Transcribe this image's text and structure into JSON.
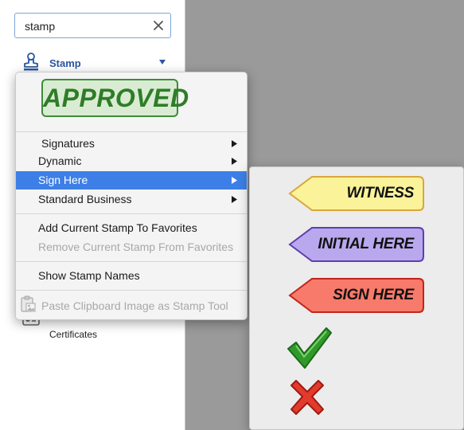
{
  "search": {
    "value": "stamp"
  },
  "tool": {
    "label": "Stamp",
    "icon": "stamp-icon"
  },
  "certificates": {
    "label": "Certificates",
    "icon": "certificate-icon"
  },
  "menu": {
    "preview_stamp_text": "APPROVED",
    "items": [
      {
        "label": "Signatures",
        "has_submenu": true,
        "state": "normal"
      },
      {
        "label": "Dynamic",
        "has_submenu": true,
        "state": "normal"
      },
      {
        "label": "Sign Here",
        "has_submenu": true,
        "state": "highlighted"
      },
      {
        "label": "Standard Business",
        "has_submenu": true,
        "state": "normal"
      },
      {
        "label": "Add Current Stamp To Favorites",
        "state": "normal"
      },
      {
        "label": "Remove Current Stamp From Favorites",
        "state": "disabled"
      },
      {
        "label": "Show Stamp Names",
        "state": "normal"
      },
      {
        "label": "Paste Clipboard Image as Stamp Tool",
        "state": "disabled",
        "icon": "clipboard-image-icon"
      }
    ]
  },
  "submenu": {
    "stamps": [
      {
        "label": "WITNESS",
        "color": "#fbf39a"
      },
      {
        "label": "INITIAL HERE",
        "color": "#b9a8ee"
      },
      {
        "label": "SIGN HERE",
        "color": "#f87a6a"
      }
    ],
    "icons": [
      "checkmark-icon",
      "x-mark-icon"
    ]
  },
  "colors": {
    "accent": "#3d7fe6",
    "approved_green": "#2e7d28"
  }
}
